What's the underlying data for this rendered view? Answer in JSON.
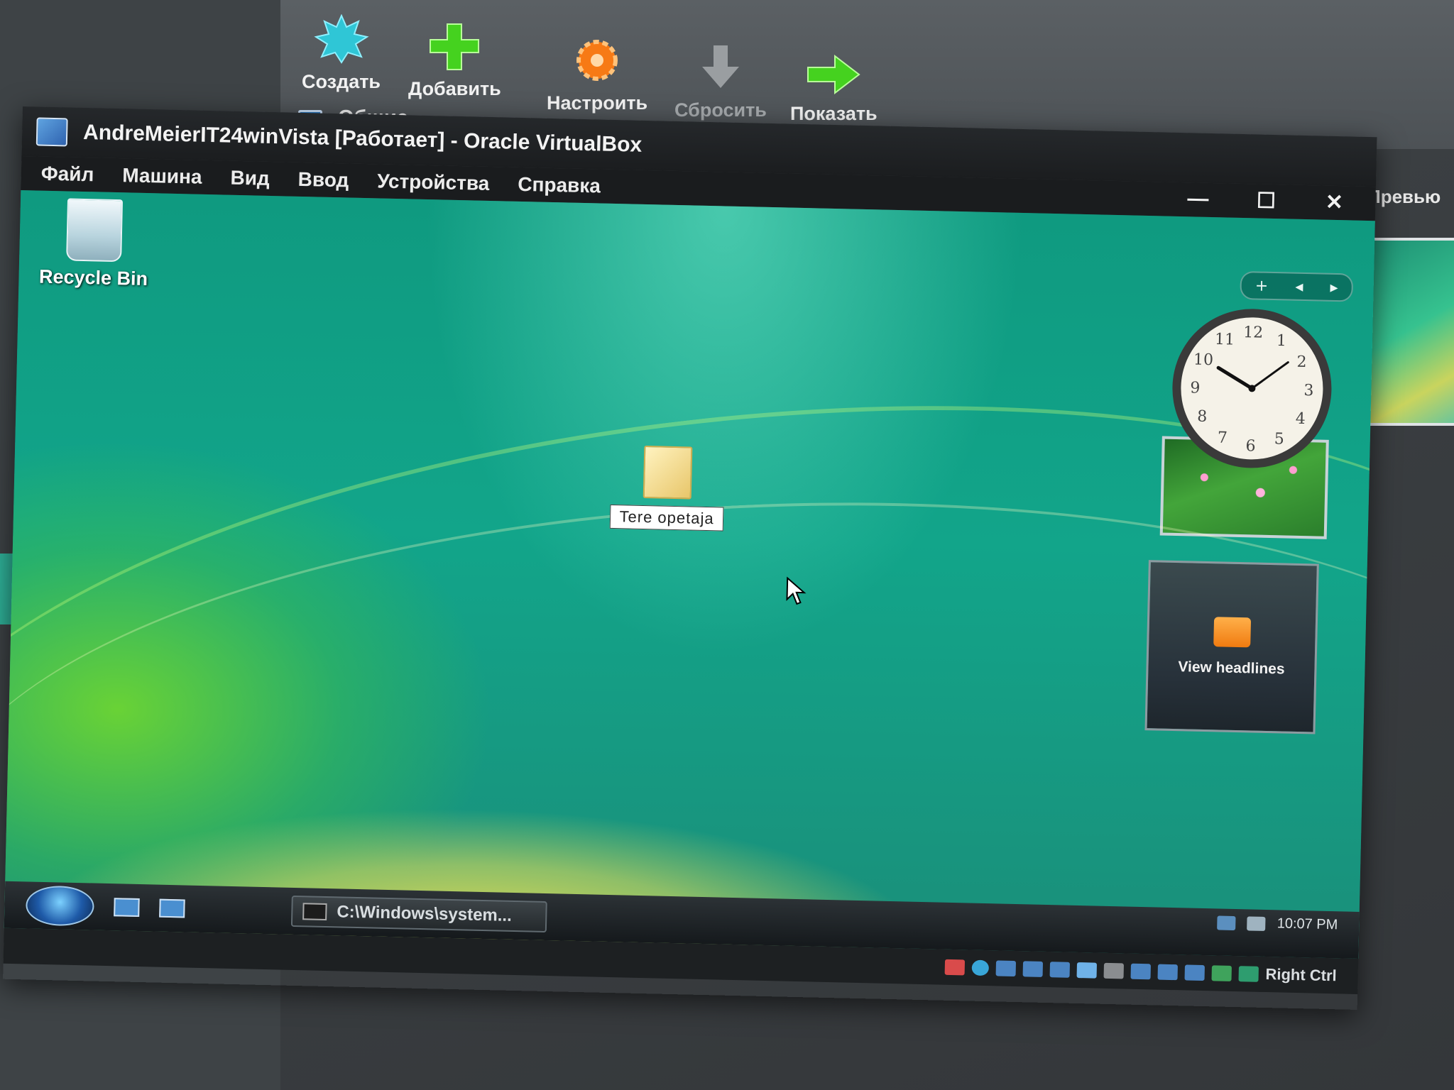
{
  "host": {
    "toolbar": [
      {
        "label": "Создать",
        "icon": "new-starburst-icon",
        "color": "#2fc6d6"
      },
      {
        "label": "Добавить",
        "icon": "add-plus-icon",
        "color": "#45d21f"
      },
      {
        "label": "Настроить",
        "icon": "settings-gear-icon",
        "color": "#f77a15"
      },
      {
        "label": "Сбросить",
        "icon": "discard-arrow-down-icon",
        "color": "#9a9ea1"
      },
      {
        "label": "Показать",
        "icon": "show-arrow-right-icon",
        "color": "#45d21f"
      }
    ],
    "details_tab": "Общие",
    "preview_label": "Превью"
  },
  "vm_window": {
    "title": "AndreMeierIT24winVista [Работает] - Oracle VirtualBox",
    "menu": [
      "Файл",
      "Машина",
      "Вид",
      "Ввод",
      "Устройства",
      "Справка"
    ],
    "controls": {
      "minimize": "—",
      "maximize": "☐",
      "close": "✕"
    }
  },
  "desktop": {
    "recycle_bin_label": "Recycle Bin",
    "folder_label": "Tere opetaja",
    "gadget_controls": {
      "add": "+",
      "prev": "◂",
      "next": "▸"
    },
    "clock": {
      "time": "10:07",
      "numerals": [
        "12",
        "1",
        "2",
        "3",
        "4",
        "5",
        "6",
        "7",
        "8",
        "9",
        "10",
        "11"
      ]
    },
    "feed_label": "View headlines"
  },
  "taskbar": {
    "task_button_label": "C:\\Windows\\system...",
    "clock": "10:07 PM"
  },
  "vm_status": {
    "host_key": "Right Ctrl"
  },
  "colors": {
    "accent": "#12a58a",
    "window_title_bg": "#1b1d1f"
  }
}
